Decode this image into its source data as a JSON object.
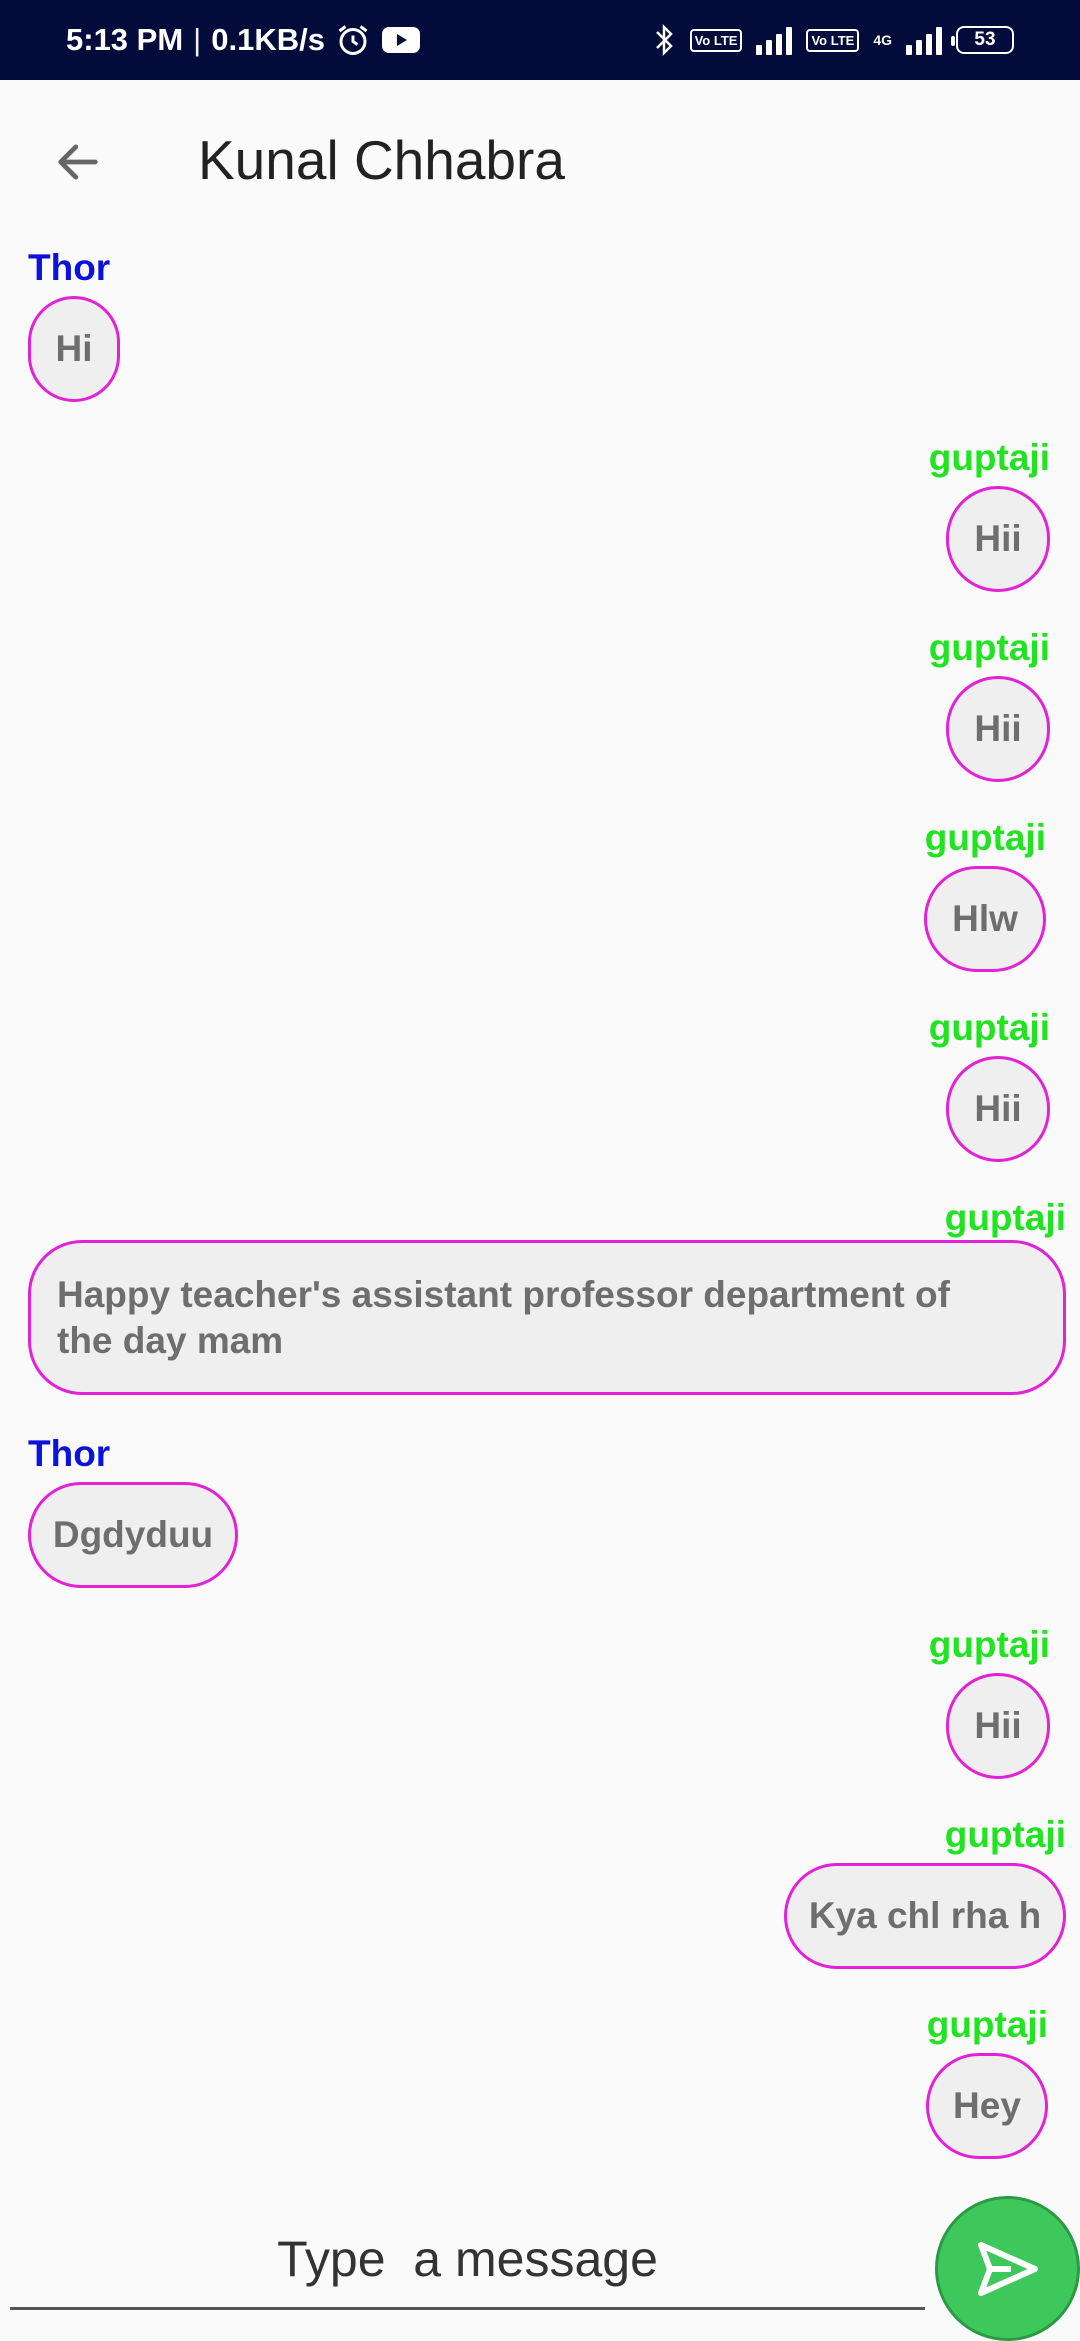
{
  "status_bar": {
    "time": "5:13 PM",
    "speed": "0.1KB/s",
    "separator": "|",
    "battery": "53",
    "volte1": "Vo LTE",
    "volte2": "Vo LTE",
    "network": "4G"
  },
  "header": {
    "title": "Kunal Chhabra"
  },
  "messages": [
    {
      "sender": "Thor",
      "text": "Hi"
    },
    {
      "sender": "guptaji",
      "text": "Hii"
    },
    {
      "sender": "guptaji",
      "text": "Hii"
    },
    {
      "sender": "guptaji",
      "text": "Hlw"
    },
    {
      "sender": "guptaji",
      "text": "Hii"
    },
    {
      "sender": "guptaji",
      "text": "Happy teacher's assistant professor department of the day mam"
    },
    {
      "sender": "Thor",
      "text": "Dgdyduu"
    },
    {
      "sender": "guptaji",
      "text": "Hii"
    },
    {
      "sender": "guptaji",
      "text": "Kya chl rha h"
    },
    {
      "sender": "guptaji",
      "text": "Hey"
    }
  ],
  "composer": {
    "placeholder": "Type  a message"
  },
  "colors": {
    "status_bar_bg": "#020b3a",
    "thor_name": "#0b13d8",
    "gupta_name": "#22e322",
    "bubble_border": "#e321d6",
    "send_button": "#3ec75a"
  },
  "icons": {
    "back": "arrow-left-icon",
    "send": "send-icon",
    "alarm": "alarm-icon",
    "youtube": "youtube-icon",
    "bluetooth": "bluetooth-icon"
  }
}
